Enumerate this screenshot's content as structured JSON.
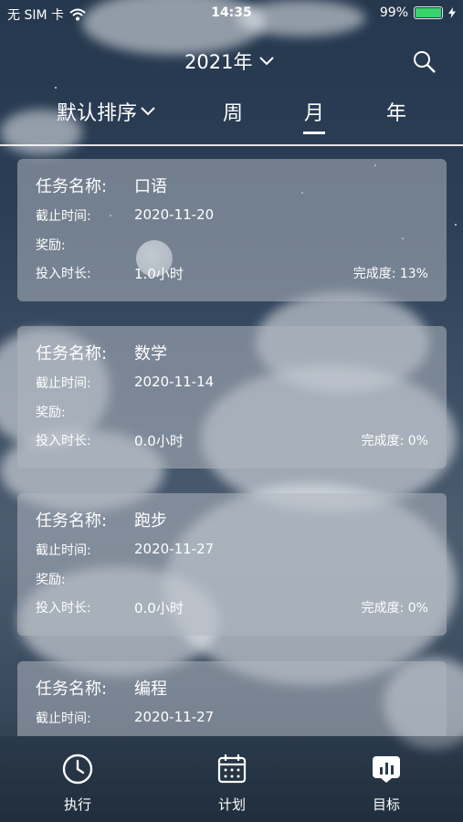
{
  "status_bar": {
    "carrier": "无 SIM 卡",
    "time": "14:35",
    "battery": "99%",
    "battery_level": 0.99,
    "battery_color": "#38d36a"
  },
  "header": {
    "year_label": "2021年",
    "search_icon": "search-icon"
  },
  "tabs": {
    "sort_label": "默认排序",
    "week": "周",
    "month": "月",
    "year": "年",
    "active": "月"
  },
  "tasks": [
    {
      "name_label": "任务名称:",
      "name": "口语",
      "deadline_label": "截止时间:",
      "deadline": "2020-11-20",
      "reward_label": "奖励:",
      "hours_label": "投入时长:",
      "hours": "1.0小时",
      "progress": "完成度: 13%"
    },
    {
      "name_label": "任务名称:",
      "name": "数学",
      "deadline_label": "截止时间:",
      "deadline": "2020-11-14",
      "reward_label": "奖励:",
      "hours_label": "投入时长:",
      "hours": "0.0小时",
      "progress": "完成度: 0%"
    },
    {
      "name_label": "任务名称:",
      "name": "跑步",
      "deadline_label": "截止时间:",
      "deadline": "2020-11-27",
      "reward_label": "奖励:",
      "hours_label": "投入时长:",
      "hours": "0.0小时",
      "progress": "完成度: 0%"
    },
    {
      "name_label": "任务名称:",
      "name": "编程",
      "deadline_label": "截止时间:",
      "deadline": "2020-11-27"
    }
  ],
  "tabbar": {
    "execute": "执行",
    "plan": "计划",
    "goal": "目标"
  }
}
